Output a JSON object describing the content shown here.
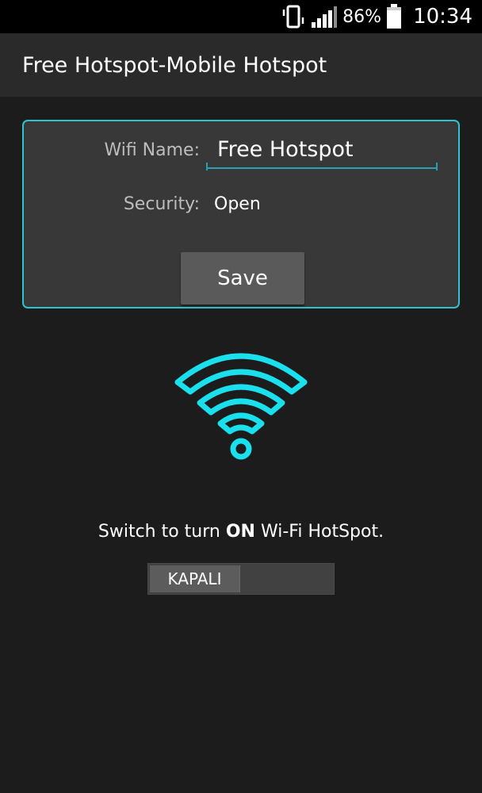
{
  "status_bar": {
    "battery_percent": "86%",
    "time": "10:34",
    "icons": [
      "vibrate-icon",
      "signal-icon",
      "battery-icon"
    ]
  },
  "app": {
    "title": "Free Hotspot-Mobile Hotspot"
  },
  "form": {
    "wifi_name_label": "Wifi Name:",
    "wifi_name_value": "Free Hotspot",
    "security_label": "Security:",
    "security_value": "Open",
    "save_label": "Save"
  },
  "hotspot": {
    "instruction_prefix": "Switch to turn ",
    "instruction_bold": "ON",
    "instruction_suffix": " Wi-Fi HotSpot.",
    "toggle_label": "KAPALI",
    "toggle_on": false
  },
  "colors": {
    "accent": "#2ec4cf",
    "wifi_icon": "#19e0ec",
    "background": "#1c1c1c"
  }
}
